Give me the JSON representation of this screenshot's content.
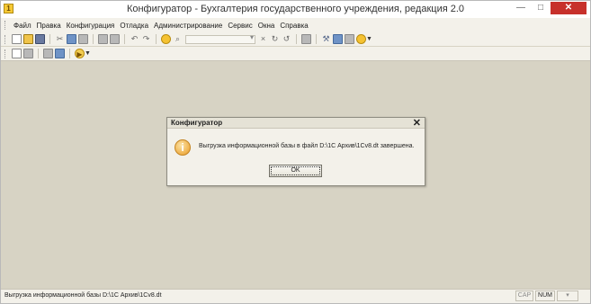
{
  "window": {
    "title": "Конфигуратор - Бухгалтерия государственного учреждения, редакция 2.0",
    "app_icon_glyph": "1",
    "minimize_glyph": "—",
    "maximize_glyph": "□",
    "close_glyph": "✕"
  },
  "menu": {
    "items": [
      {
        "label": "Файл"
      },
      {
        "label": "Правка"
      },
      {
        "label": "Конфигурация"
      },
      {
        "label": "Отладка"
      },
      {
        "label": "Администрирование"
      },
      {
        "label": "Сервис"
      },
      {
        "label": "Окна"
      },
      {
        "label": "Справка"
      }
    ]
  },
  "toolbar": {
    "search_value": "",
    "icons": [
      "new-document-icon",
      "open-folder-icon",
      "save-icon",
      "cut-icon",
      "copy-icon",
      "paste-icon",
      "print-icon",
      "print-preview-icon",
      "undo-icon",
      "redo-icon",
      "find-icon",
      "zoom-icon",
      "clear-search-icon",
      "find-next-icon",
      "find-previous-icon",
      "bookmark-icon",
      "tools-icon",
      "calculator-icon",
      "calendar-icon",
      "help-icon"
    ],
    "second_row_icons": [
      "configuration-tree-icon",
      "database-icon",
      "compare-icon",
      "table-icon",
      "run-icon"
    ]
  },
  "dialog": {
    "title": "Конфигуратор",
    "close_glyph": "✕",
    "info_glyph": "i",
    "message": "Выгрузка информационной базы в файл D:\\1C Архив\\1Cv8.dt завершена.",
    "ok_label": "OK"
  },
  "status": {
    "text": "Выгрузка информационной базы D:\\1C Архив\\1Cv8.dt",
    "cap": "CAP",
    "num": "NUM",
    "extra": "▾"
  }
}
